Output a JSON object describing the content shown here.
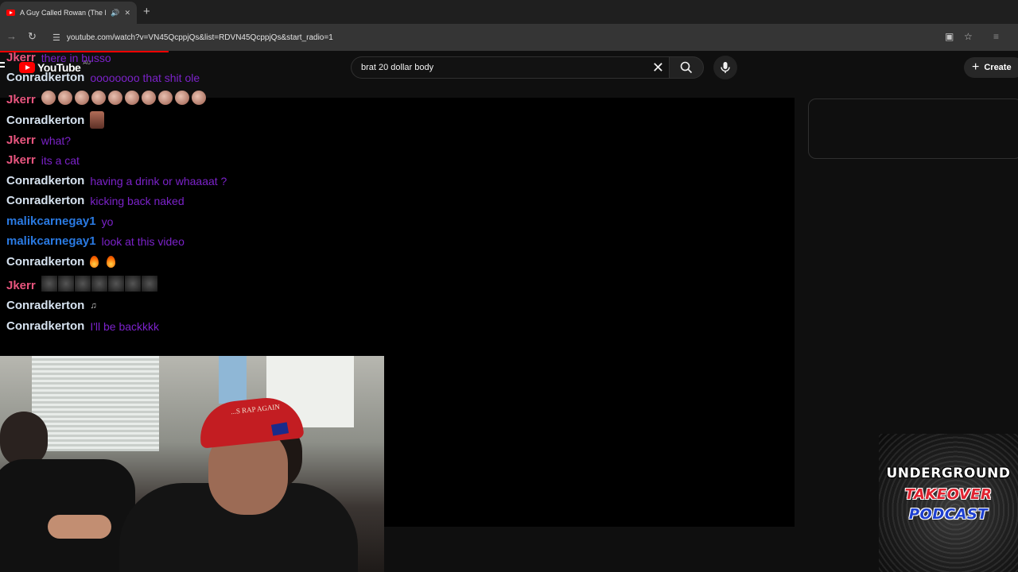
{
  "browser": {
    "tab_title": "A Guy Called Rowan (The D",
    "url": "youtube.com/watch?v=VN45QcppjQs&list=RDVN45QcppjQs&start_radio=1",
    "new_tab_symbol": "+"
  },
  "youtube": {
    "logo_text": "YouTube",
    "logo_country": "AU",
    "search_query": "brat 20 dollar body",
    "create_label": "Create"
  },
  "chat": {
    "messages": [
      {
        "user": "Jkerr",
        "text": "there in busso"
      },
      {
        "user": "Conradkerton",
        "text": "oooooooo that shit ole"
      },
      {
        "user": "Jkerr",
        "text": ""
      },
      {
        "user": "Conradkerton",
        "text": ""
      },
      {
        "user": "Jkerr",
        "text": "what?"
      },
      {
        "user": "Jkerr",
        "text": "its a cat"
      },
      {
        "user": "Conradkerton",
        "text": "having a drink or whaaaat ?"
      },
      {
        "user": "Conradkerton",
        "text": "kicking back naked"
      },
      {
        "user": "malikcarnegay1",
        "text": "yo"
      },
      {
        "user": "malikcarnegay1",
        "text": "look at this video"
      },
      {
        "user": "Conradkerton",
        "text": ""
      },
      {
        "user": "Jkerr",
        "text": ""
      },
      {
        "user": "Conradkerton",
        "text": ""
      },
      {
        "user": "Conradkerton",
        "text": "I'll be backkkk"
      }
    ]
  },
  "webcam": {
    "cap_text": "...S RAP AGAIN"
  },
  "podcast_logo": {
    "line1": "UNDERGROUND",
    "line2": "TAKEOVER",
    "line3": "PODCAST"
  },
  "colors": {
    "accent_red": "#ff0000",
    "chat_message": "#7b22c9",
    "user_jkerr": "#e8557e",
    "user_conradkerton": "#d7e3f0",
    "user_malikcarnegay1": "#2a7ae2"
  }
}
